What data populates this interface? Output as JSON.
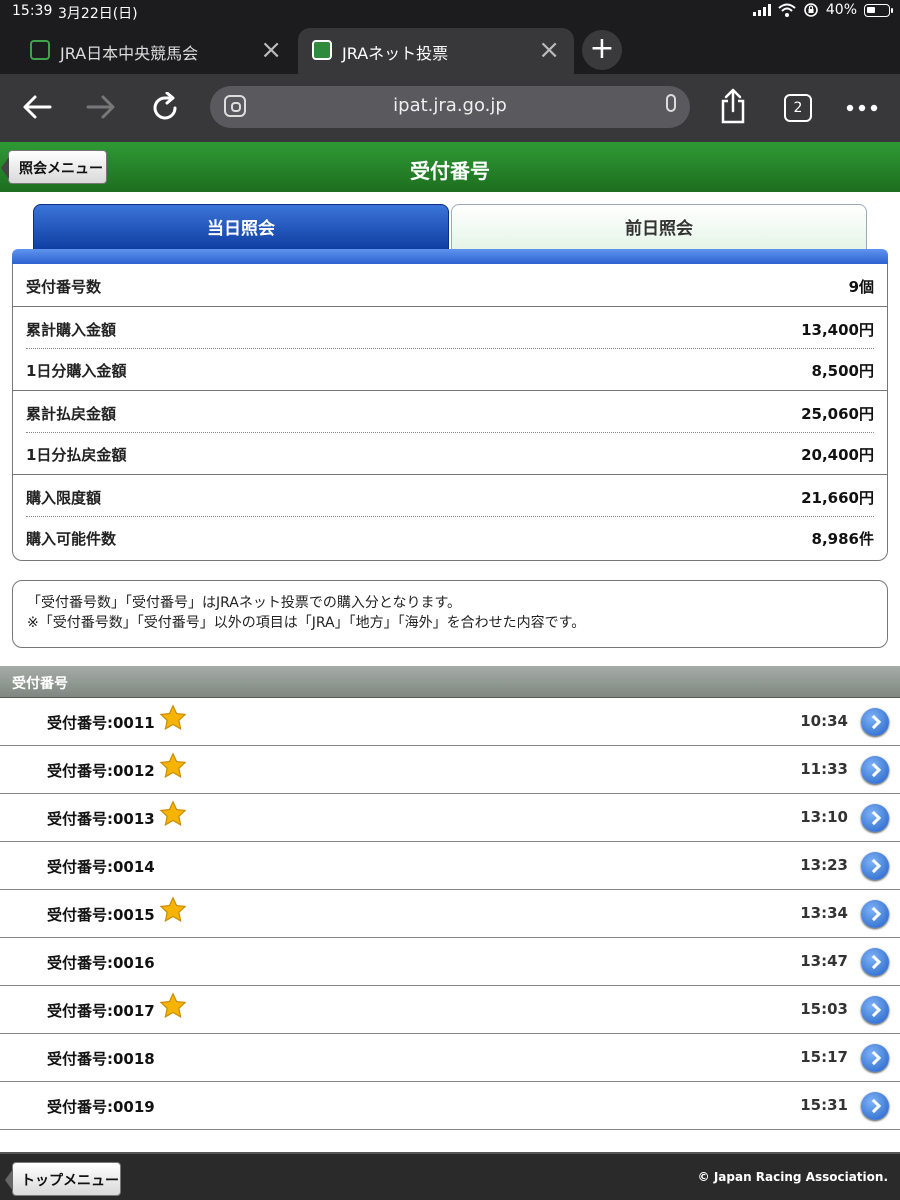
{
  "status": {
    "time": "15:39",
    "date": "3月22日(日)",
    "battery": "40%"
  },
  "browser": {
    "tabs": [
      {
        "title": "JRA日本中央競馬会",
        "active": false
      },
      {
        "title": "JRAネット投票",
        "active": true
      }
    ],
    "address": "ipat.jra.go.jp",
    "tab_count": "2"
  },
  "header": {
    "back_label": "照会メニュー",
    "title": "受付番号"
  },
  "segments": {
    "today": "当日照会",
    "yesterday": "前日照会"
  },
  "summary": [
    {
      "label": "受付番号数",
      "value": "9個"
    },
    {
      "label": "累計購入金額",
      "value": "13,400円"
    },
    {
      "label": "1日分購入金額",
      "value": "8,500円"
    },
    {
      "label": "累計払戻金額",
      "value": "25,060円"
    },
    {
      "label": "1日分払戻金額",
      "value": "20,400円"
    },
    {
      "label": "購入限度額",
      "value": "21,660円"
    },
    {
      "label": "購入可能件数",
      "value": "8,986件"
    }
  ],
  "notice": {
    "line1": "「受付番号数」「受付番号」はJRAネット投票での購入分となります。",
    "line2": "※「受付番号数」「受付番号」以外の項目は「JRA」「地方」「海外」を合わせた内容です。"
  },
  "list_title": "受付番号",
  "receipts": [
    {
      "label": "受付番号:0011",
      "time": "10:34",
      "starred": true
    },
    {
      "label": "受付番号:0012",
      "time": "11:33",
      "starred": true
    },
    {
      "label": "受付番号:0013",
      "time": "13:10",
      "starred": true
    },
    {
      "label": "受付番号:0014",
      "time": "13:23",
      "starred": false
    },
    {
      "label": "受付番号:0015",
      "time": "13:34",
      "starred": true
    },
    {
      "label": "受付番号:0016",
      "time": "13:47",
      "starred": false
    },
    {
      "label": "受付番号:0017",
      "time": "15:03",
      "starred": true
    },
    {
      "label": "受付番号:0018",
      "time": "15:17",
      "starred": false
    },
    {
      "label": "受付番号:0019",
      "time": "15:31",
      "starred": false
    }
  ],
  "footer": {
    "top_label": "トップメニュー",
    "copyright": "© Japan Racing Association."
  },
  "colors": {
    "header_green": "#1d6e1f",
    "tab_blue": "#0d3c9e",
    "star": "#f5b400"
  }
}
